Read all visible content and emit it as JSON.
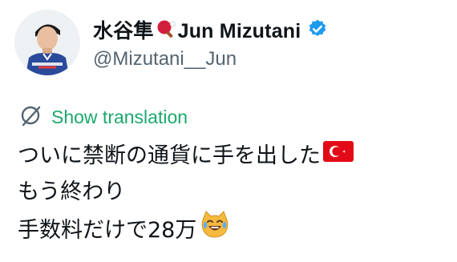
{
  "user": {
    "name_jp": "水谷隼",
    "name_en": "Jun Mizutani",
    "handle": "@Mizutani__Jun",
    "verified": true,
    "name_emoji": "ping-pong-icon",
    "avatar": "avatar-photo"
  },
  "translation": {
    "label": "Show translation",
    "icon": "translate-icon",
    "color": "#1ca96b"
  },
  "tweet": {
    "lines": [
      "ついに禁断の通貨に手を出した",
      "もう終わり",
      "手数料だけで28万"
    ],
    "line1_emoji": "turkey-flag-icon",
    "line3_emoji": "laughing-cat-icon"
  },
  "colors": {
    "verified_badge": "#1d9bf0",
    "handle": "#536471",
    "text": "#0f1419",
    "flag_red": "#e30a17"
  }
}
